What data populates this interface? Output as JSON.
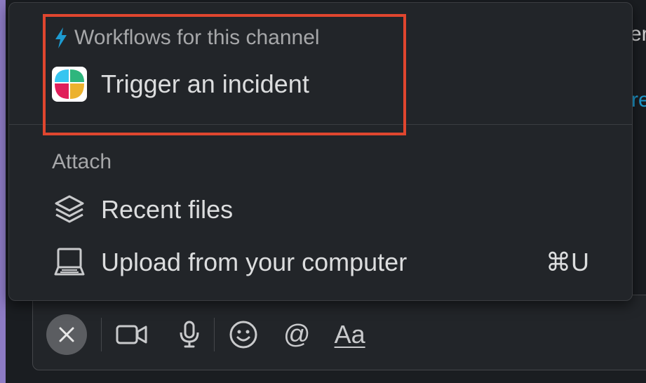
{
  "background": {
    "right_text_top": "er",
    "right_text_link": "re"
  },
  "menu": {
    "workflows": {
      "title": "Workflows for this channel",
      "icon": "lightning-bolt-icon",
      "items": [
        {
          "label": "Trigger an incident",
          "icon": "workflow-app-icon"
        }
      ]
    },
    "attach": {
      "title": "Attach",
      "items": [
        {
          "label": "Recent files",
          "icon": "layers-icon"
        },
        {
          "label": "Upload from your computer",
          "icon": "laptop-icon",
          "shortcut": "⌘U"
        }
      ]
    }
  },
  "toolbar": {
    "close_icon": "close-icon",
    "video_icon": "video-camera-icon",
    "mic_icon": "microphone-icon",
    "emoji_icon": "emoji-icon",
    "mention_label": "@",
    "format_label": "Aa"
  },
  "colors": {
    "highlight": "#e0462f",
    "accent_blue": "#1d9bd1",
    "frame_purple": "#8d7bc4"
  }
}
